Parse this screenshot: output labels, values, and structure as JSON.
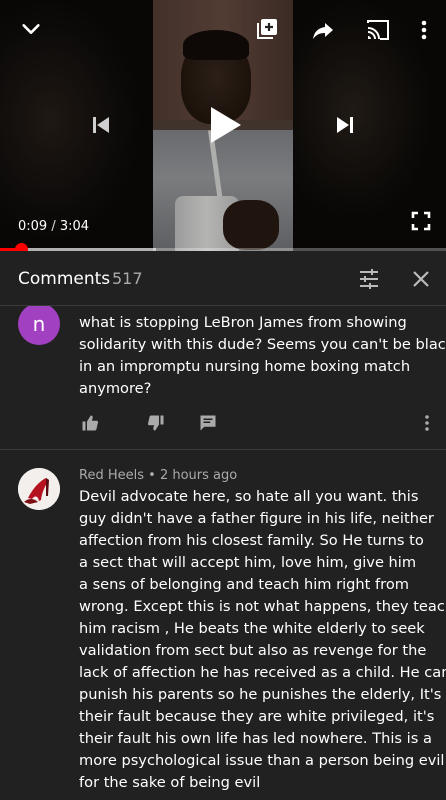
{
  "player": {
    "time_current": "0:09",
    "time_separator": " / ",
    "time_total": "3:04",
    "progress_fraction": 0.049,
    "buffered_fraction": 0.35,
    "icons": {
      "collapse": "chevron-down-icon",
      "add_to_playlist": "add-to-playlist-icon",
      "share": "share-icon",
      "cast": "cast-icon",
      "more": "more-vert-icon",
      "previous": "skip-previous-icon",
      "play": "play-icon",
      "next": "skip-next-icon",
      "fullscreen": "fullscreen-icon"
    }
  },
  "comments_header": {
    "title": "Comments",
    "count": "517",
    "sort_icon": "sort-icon",
    "close_icon": "close-icon"
  },
  "comments": [
    {
      "avatar_letter": "n",
      "avatar_color": "#a240c2",
      "lines": [
        "what is stopping LeBron James from showing",
        "solidarity with this dude? Seems you can't be black",
        "in an impromptu nursing home boxing match",
        "anymore?"
      ]
    },
    {
      "author": "Red Heels",
      "separator": " • ",
      "time": "2 hours ago",
      "lines": [
        "Devil advocate here, so hate all you want. this",
        "guy didn't have a father figure in his life, neither",
        "affection from his closest family. So He turns to",
        "a sect that will accept him, love him, give him",
        "a sens of belonging and teach him right from",
        "wrong.  Except this is not what happens, they teach",
        "him racism , He beats the white elderly to seek",
        "validation from sect but also as revenge for the",
        "lack of affection he has received as a child. He can't",
        "punish his parents so he punishes the elderly, It's",
        "their fault because they are white privileged, it's",
        "their fault his own life has led nowhere. This is a",
        "more psychological issue than a person being evil",
        "for the sake of being evil"
      ]
    }
  ],
  "colors": {
    "background": "#212121",
    "progress": "#ff0000",
    "secondary_text": "#aaaaaa"
  }
}
